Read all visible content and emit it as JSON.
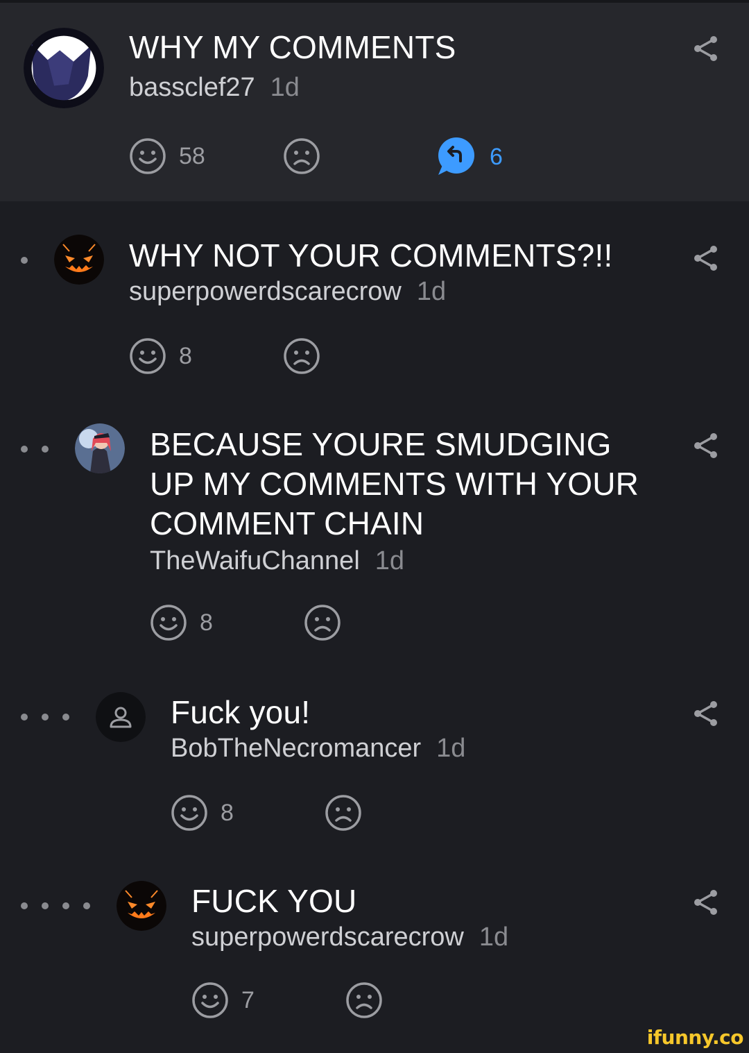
{
  "comments": [
    {
      "text": "WHY MY COMMENTS",
      "author": "bassclef27",
      "time": "1d",
      "likes": "58",
      "replies": "6",
      "avatar": "wolf-avatar"
    },
    {
      "text": "WHY NOT YOUR COMMENTS?!!",
      "author": "superpowerdscarecrow",
      "time": "1d",
      "likes": "8",
      "avatar": "pumpkin-avatar"
    },
    {
      "text": "BECAUSE YOURE SMUDGING UP MY COMMENTS WITH YOUR COMMENT CHAIN",
      "author": "TheWaifuChannel",
      "time": "1d",
      "likes": "8",
      "avatar": "anime-avatar"
    },
    {
      "text": "Fuck you!",
      "author": "BobTheNecromancer",
      "time": "1d",
      "likes": "8",
      "avatar": "default-user-avatar"
    },
    {
      "text": "FUCK YOU",
      "author": "superpowerdscarecrow",
      "time": "1d",
      "likes": "7",
      "avatar": "pumpkin-avatar"
    }
  ],
  "icons": {
    "like": "smile-icon",
    "dislike": "frown-icon",
    "reply": "reply-bubble-icon",
    "share": "share-icon"
  },
  "colors": {
    "background": "#1c1d22",
    "highlight": "#26272c",
    "reply_accent": "#3d9bff",
    "watermark": "#f6c72b"
  },
  "watermark": "ifunny.co"
}
